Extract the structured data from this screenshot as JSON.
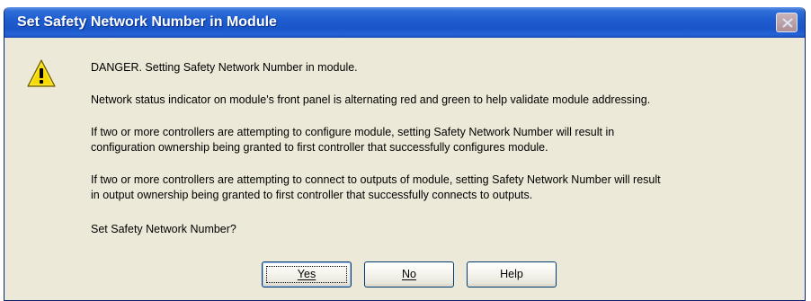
{
  "dialog": {
    "title": "Set Safety Network Number in Module",
    "close_icon": "close-icon",
    "warning_icon": "warning-icon"
  },
  "message": {
    "line1": "DANGER. Setting Safety Network Number in module.",
    "line2": "Network status indicator on module's front panel is alternating red and green to help validate module addressing.",
    "line3a": "If two or more controllers are attempting to configure module, setting Safety Network Number will result in",
    "line3b": "configuration ownership being granted to first controller that successfully configures module.",
    "line4a": "If two or more controllers are attempting to connect to outputs of module, setting Safety Network Number will result",
    "line4b": "in output ownership being granted to first controller that successfully connects to outputs.",
    "question": "Set Safety Network Number?"
  },
  "buttons": {
    "yes": "Yes",
    "no": "No",
    "help": "Help"
  },
  "colors": {
    "titlebar": "#1f5dd0",
    "dialog_bg": "#ece9d8",
    "warning_yellow": "#f5d800"
  }
}
